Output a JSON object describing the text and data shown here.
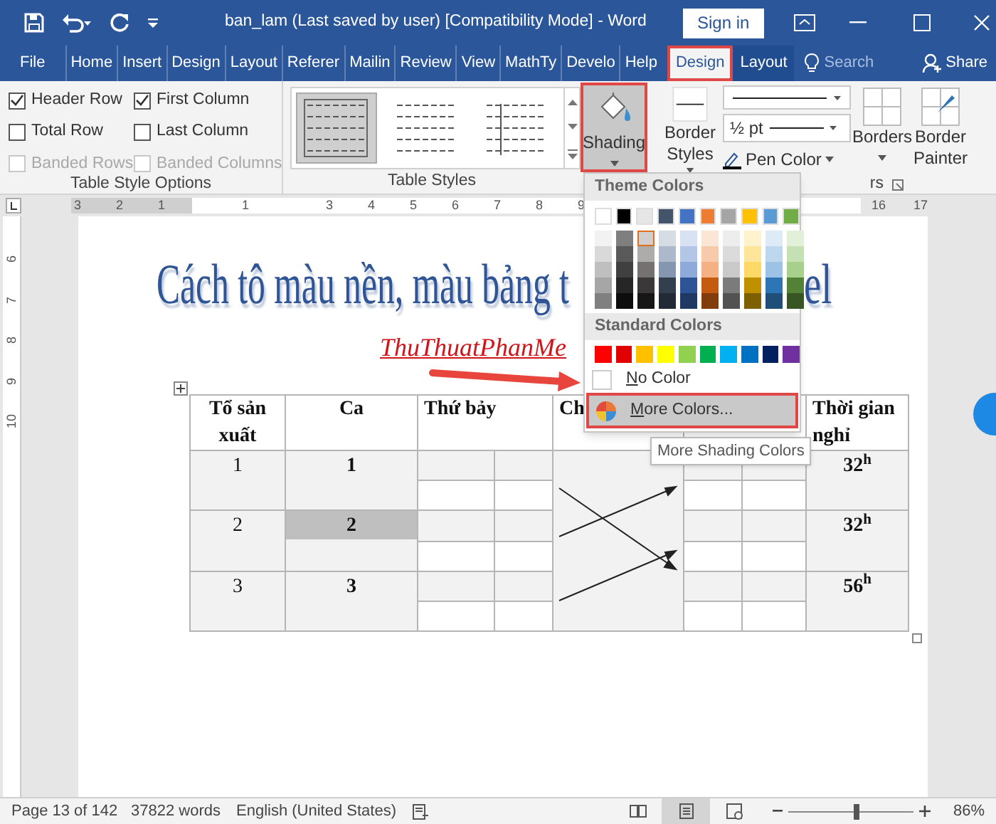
{
  "title_bar": {
    "title": "ban_lam (Last saved by user) [Compatibility Mode]  -  Word",
    "sign_in": "Sign in"
  },
  "tabs": [
    {
      "label": "File",
      "kind": "normal",
      "selected": false
    },
    {
      "label": "Home",
      "kind": "normal",
      "selected": false
    },
    {
      "label": "Insert",
      "kind": "normal",
      "selected": false
    },
    {
      "label": "Design",
      "kind": "normal",
      "selected": false
    },
    {
      "label": "Layout",
      "kind": "normal",
      "selected": false
    },
    {
      "label": "Referer",
      "kind": "normal",
      "selected": false
    },
    {
      "label": "Mailin",
      "kind": "normal",
      "selected": false
    },
    {
      "label": "Review",
      "kind": "normal",
      "selected": false
    },
    {
      "label": "View",
      "kind": "normal",
      "selected": false
    },
    {
      "label": "MathTy",
      "kind": "normal",
      "selected": false
    },
    {
      "label": "Develo",
      "kind": "normal",
      "selected": false
    },
    {
      "label": "Help",
      "kind": "normal",
      "selected": false
    },
    {
      "label": "Design",
      "kind": "contextual",
      "selected": true
    },
    {
      "label": "Layout",
      "kind": "contextual",
      "selected": false
    }
  ],
  "search": {
    "placeholder": "Search"
  },
  "share": "Share",
  "ribbon": {
    "style_options": {
      "label": "Table Style Options",
      "checkboxes": [
        {
          "label": "Header Row",
          "checked": true,
          "disabled": false
        },
        {
          "label": "First Column",
          "checked": true,
          "disabled": false
        },
        {
          "label": "Total Row",
          "checked": false,
          "disabled": false
        },
        {
          "label": "Last Column",
          "checked": false,
          "disabled": false
        },
        {
          "label": "Banded Rows",
          "checked": false,
          "disabled": true
        },
        {
          "label": "Banded Columns",
          "checked": false,
          "disabled": true
        }
      ]
    },
    "table_styles": {
      "label": "Table Styles",
      "styles": [
        {
          "selected": true
        },
        {
          "selected": false
        },
        {
          "selected": false
        }
      ]
    },
    "shading": {
      "label": "Shading",
      "pressed": true
    },
    "border_styles": {
      "label": "Border Styles"
    },
    "line_weight": "½ pt",
    "pen_color": "Pen Color",
    "borders": "Borders",
    "border_painter": "Border Painter",
    "borders_group_label": "rs"
  },
  "ruler": {
    "labels": [
      "3",
      "2",
      "1",
      "1",
      "3",
      "4",
      "5",
      "6",
      "7",
      "8",
      "9",
      "16",
      "17"
    ]
  },
  "vertical_ruler": {
    "labels": [
      "6",
      "7",
      "8",
      "9",
      "10"
    ]
  },
  "document": {
    "heading_left": "Cách tô màu nền,  màu bảng t",
    "heading_right": "el",
    "subtitle": "ThuThuatPhanMe",
    "table": {
      "header": [
        {
          "text": "Tổ sản xuất"
        },
        {
          "text": "Ca"
        },
        {
          "text": "Thứ bảy"
        },
        {
          "text": "Ch"
        },
        {
          "text": "Thời gian nghỉ"
        }
      ],
      "rows": [
        {
          "group": "1",
          "shift": "1",
          "rest": "32$^{h}$",
          "highlighted": false
        },
        {
          "group": "2",
          "shift": "2",
          "rest": "32$^{h}$",
          "highlighted": true
        },
        {
          "group": "3",
          "shift": "3",
          "rest": "56$^{h}$",
          "highlighted": false
        }
      ]
    }
  },
  "shading_menu": {
    "theme_label": "Theme Colors",
    "theme_colors": [
      {
        "color": "#ffffff",
        "shades": [
          {
            "color": "#f2f2f2",
            "selected": false
          },
          {
            "color": "#d9d9d9",
            "selected": false
          },
          {
            "color": "#bfbfbf",
            "selected": false
          },
          {
            "color": "#a6a6a6",
            "selected": false
          },
          {
            "color": "#808080",
            "selected": false
          }
        ]
      },
      {
        "color": "#000000",
        "shades": [
          {
            "color": "#7f7f7f",
            "selected": false
          },
          {
            "color": "#595959",
            "selected": false
          },
          {
            "color": "#404040",
            "selected": false
          },
          {
            "color": "#262626",
            "selected": false
          },
          {
            "color": "#0d0d0d",
            "selected": false
          }
        ]
      },
      {
        "color": "#e7e6e6",
        "shades": [
          {
            "color": "#d0cece",
            "selected": true
          },
          {
            "color": "#aeabab",
            "selected": false
          },
          {
            "color": "#757171",
            "selected": false
          },
          {
            "color": "#3a3838",
            "selected": false
          },
          {
            "color": "#171616",
            "selected": false
          }
        ]
      },
      {
        "color": "#44546a",
        "shades": [
          {
            "color": "#d6dce4",
            "selected": false
          },
          {
            "color": "#adb9ca",
            "selected": false
          },
          {
            "color": "#8496b0",
            "selected": false
          },
          {
            "color": "#333f4f",
            "selected": false
          },
          {
            "color": "#222a35",
            "selected": false
          }
        ]
      },
      {
        "color": "#4472c4",
        "shades": [
          {
            "color": "#d9e2f3",
            "selected": false
          },
          {
            "color": "#b4c6e7",
            "selected": false
          },
          {
            "color": "#8eaadb",
            "selected": false
          },
          {
            "color": "#2f5496",
            "selected": false
          },
          {
            "color": "#1f3864",
            "selected": false
          }
        ]
      },
      {
        "color": "#ed7d31",
        "shades": [
          {
            "color": "#fbe5d5",
            "selected": false
          },
          {
            "color": "#f7caac",
            "selected": false
          },
          {
            "color": "#f4b183",
            "selected": false
          },
          {
            "color": "#c55a11",
            "selected": false
          },
          {
            "color": "#833c0b",
            "selected": false
          }
        ]
      },
      {
        "color": "#a5a5a5",
        "shades": [
          {
            "color": "#ededed",
            "selected": false
          },
          {
            "color": "#dbdbdb",
            "selected": false
          },
          {
            "color": "#c9c9c9",
            "selected": false
          },
          {
            "color": "#7b7b7b",
            "selected": false
          },
          {
            "color": "#525252",
            "selected": false
          }
        ]
      },
      {
        "color": "#ffc000",
        "shades": [
          {
            "color": "#fff2cc",
            "selected": false
          },
          {
            "color": "#ffe599",
            "selected": false
          },
          {
            "color": "#ffd966",
            "selected": false
          },
          {
            "color": "#bf9000",
            "selected": false
          },
          {
            "color": "#7f6000",
            "selected": false
          }
        ]
      },
      {
        "color": "#5b9bd5",
        "shades": [
          {
            "color": "#deebf6",
            "selected": false
          },
          {
            "color": "#bdd7ee",
            "selected": false
          },
          {
            "color": "#9cc3e5",
            "selected": false
          },
          {
            "color": "#2e75b5",
            "selected": false
          },
          {
            "color": "#1f4e79",
            "selected": false
          }
        ]
      },
      {
        "color": "#70ad47",
        "shades": [
          {
            "color": "#e2efd9",
            "selected": false
          },
          {
            "color": "#c5e0b3",
            "selected": false
          },
          {
            "color": "#a8d08d",
            "selected": false
          },
          {
            "color": "#538135",
            "selected": false
          },
          {
            "color": "#375623",
            "selected": false
          }
        ]
      }
    ],
    "standard_label": "Standard Colors",
    "standard_colors": [
      {
        "color": "#ff0000"
      },
      {
        "color": "#e00000"
      },
      {
        "color": "#ffc000"
      },
      {
        "color": "#ffff00"
      },
      {
        "color": "#92d050"
      },
      {
        "color": "#00b050"
      },
      {
        "color": "#00b0f0"
      },
      {
        "color": "#0070c0"
      },
      {
        "color": "#002060"
      },
      {
        "color": "#7030a0"
      }
    ],
    "items": [
      {
        "kind": "no_color",
        "label": "No Color",
        "highlighted": false
      },
      {
        "kind": "more_colors",
        "label": "More Colors...",
        "highlighted": true
      }
    ]
  },
  "tooltip": "More Shading Colors",
  "status_bar": {
    "page": "Page 13 of 142",
    "words": "37822 words",
    "language": "English (United States)",
    "views": [
      {
        "kind": "read",
        "selected": false
      },
      {
        "kind": "print",
        "selected": true
      },
      {
        "kind": "web",
        "selected": false
      }
    ],
    "zoom": {
      "level": 0.55,
      "reading": "86%"
    }
  }
}
